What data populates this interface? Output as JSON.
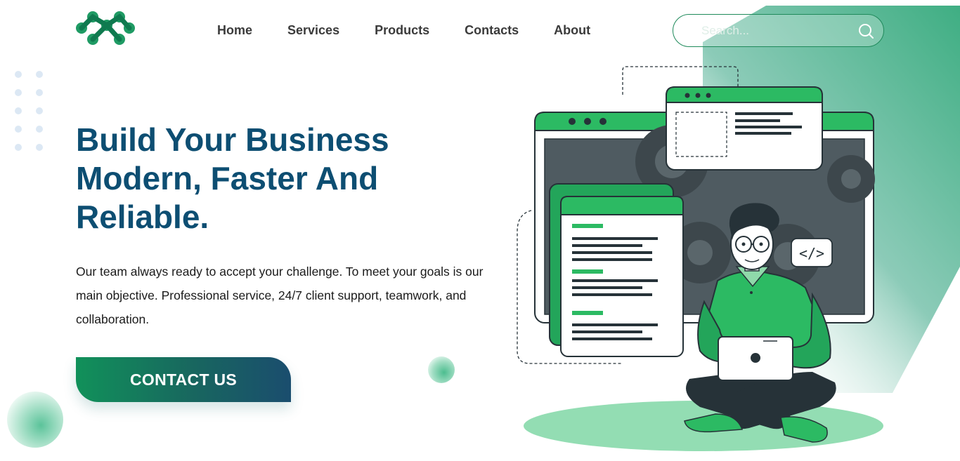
{
  "nav": {
    "items": [
      {
        "label": "Home"
      },
      {
        "label": "Services"
      },
      {
        "label": "Products"
      },
      {
        "label": "Contacts"
      },
      {
        "label": "About"
      }
    ]
  },
  "search": {
    "placeholder": "Search...",
    "icon": "search-icon"
  },
  "hero": {
    "headline_lines": [
      "Build Your Business",
      "Modern, Faster And",
      "Reliable."
    ],
    "description": "Our team always ready to accept your challenge. To meet your goals is our main objective. Professional service, 24/7 client support, teamwork, and collaboration.",
    "cta_label": "CONTACT US",
    "code_tag": "</>"
  },
  "colors": {
    "brand_green": "#2cba63",
    "heading_blue": "#0d4e72",
    "dark": "#263238"
  }
}
